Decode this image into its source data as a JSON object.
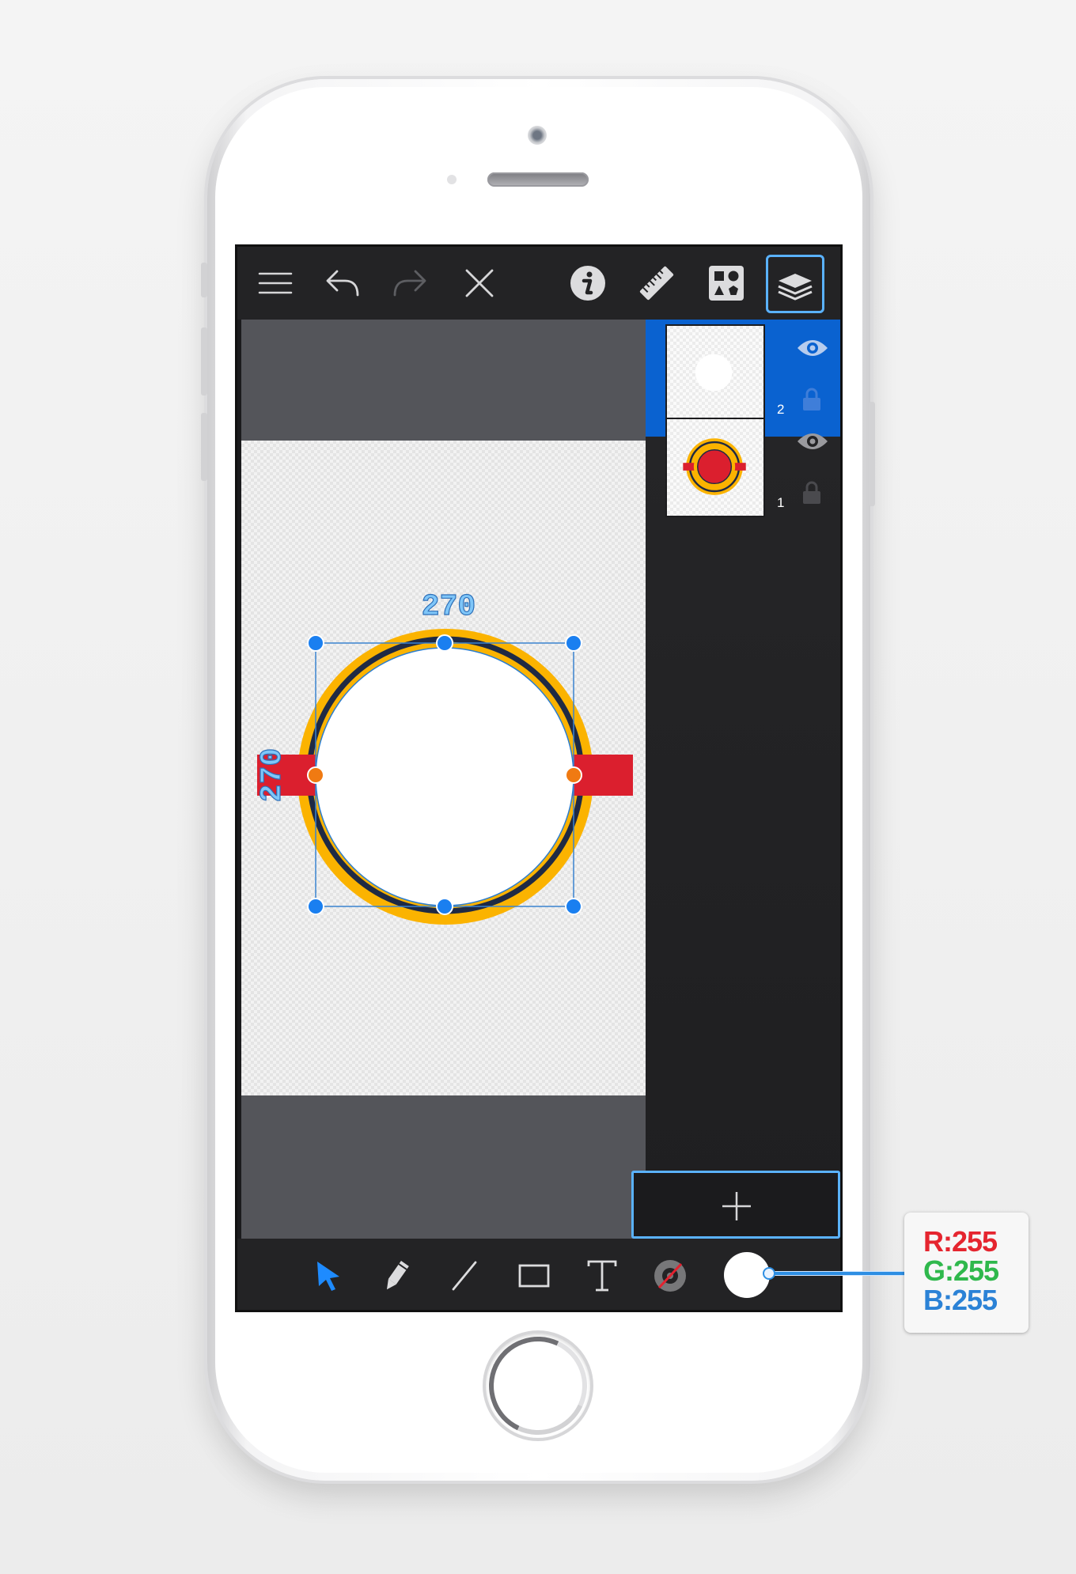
{
  "device": {
    "model": "iPhone"
  },
  "toolbar": {
    "icons": [
      "menu-icon",
      "undo-icon",
      "redo-icon",
      "close-icon",
      "info-icon",
      "ruler-icon",
      "assets-icon",
      "layers-icon"
    ],
    "active": "layers-icon",
    "accent": "#5ab2ff"
  },
  "canvas": {
    "selection": {
      "width_label": "270",
      "height_label": "270"
    },
    "colors": {
      "ring": "#fbb300",
      "outline": "#1f2a44",
      "band": "#db1f2e",
      "fill": "#ffffff",
      "handle": "#1a7ff0",
      "handle_mid": "#f07a12"
    }
  },
  "layers": {
    "items": [
      {
        "number": "2",
        "selected": true,
        "visible": true,
        "locked": false
      },
      {
        "number": "1",
        "selected": false,
        "visible": true,
        "locked": false
      }
    ],
    "selected_color": "#0a62d0",
    "add_button_label": "+"
  },
  "tools": {
    "items": [
      "select-tool-icon",
      "pencil-tool-icon",
      "line-tool-icon",
      "rectangle-tool-icon",
      "text-tool-icon",
      "stroke-color-icon",
      "fill-color-swatch"
    ],
    "active": "select-tool-icon"
  },
  "color_readout": {
    "r_label": "R",
    "r_value": "255",
    "g_label": "G",
    "g_value": "255",
    "b_label": "B",
    "b_value": "255"
  }
}
